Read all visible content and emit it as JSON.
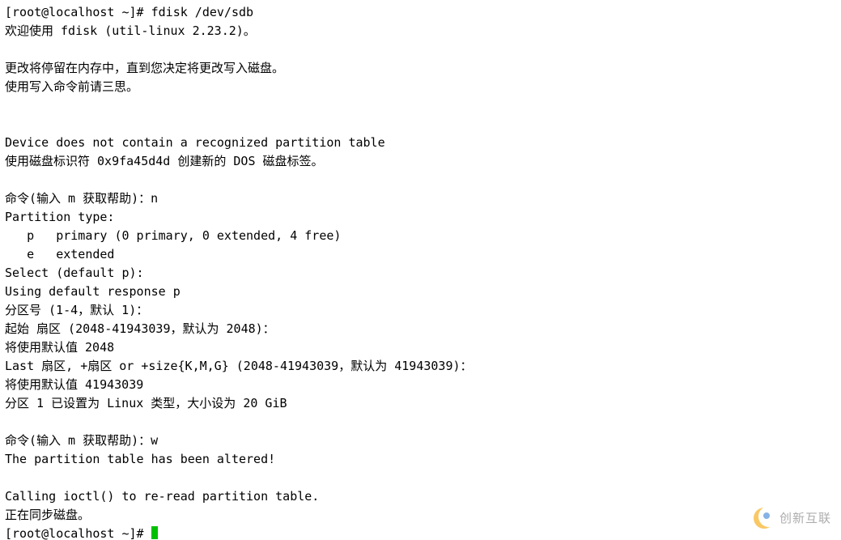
{
  "terminal": {
    "lines": [
      "[root@localhost ~]# fdisk /dev/sdb",
      "欢迎使用 fdisk (util-linux 2.23.2)。",
      "",
      "更改将停留在内存中，直到您决定将更改写入磁盘。",
      "使用写入命令前请三思。",
      "",
      "",
      "Device does not contain a recognized partition table",
      "使用磁盘标识符 0x9fa45d4d 创建新的 DOS 磁盘标签。",
      "",
      "命令(输入 m 获取帮助)：n",
      "Partition type:",
      "   p   primary (0 primary, 0 extended, 4 free)",
      "   e   extended",
      "Select (default p):",
      "Using default response p",
      "分区号 (1-4，默认 1)：",
      "起始 扇区 (2048-41943039，默认为 2048)：",
      "将使用默认值 2048",
      "Last 扇区, +扇区 or +size{K,M,G} (2048-41943039，默认为 41943039)：",
      "将使用默认值 41943039",
      "分区 1 已设置为 Linux 类型，大小设为 20 GiB",
      "",
      "命令(输入 m 获取帮助)：w",
      "The partition table has been altered!",
      "",
      "Calling ioctl() to re-read partition table.",
      "正在同步磁盘。"
    ],
    "prompt": "[root@localhost ~]# "
  },
  "watermark": {
    "text": "创新互联"
  }
}
